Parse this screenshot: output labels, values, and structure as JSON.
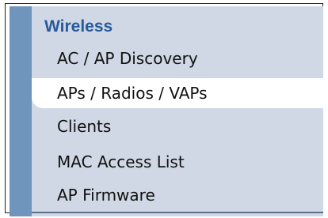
{
  "nav": {
    "section_title": "Wireless",
    "items": [
      {
        "label": "AC / AP Discovery",
        "selected": false
      },
      {
        "label": "APs / Radios / VAPs",
        "selected": true
      },
      {
        "label": "Clients",
        "selected": false
      },
      {
        "label": "MAC Access List",
        "selected": false
      },
      {
        "label": "AP Firmware",
        "selected": false
      }
    ]
  },
  "colors": {
    "left_bar": "#6f95bd",
    "panel_background": "#cfd8e4",
    "section_title": "#285a9c",
    "selected_item_background": "#ffffff"
  }
}
